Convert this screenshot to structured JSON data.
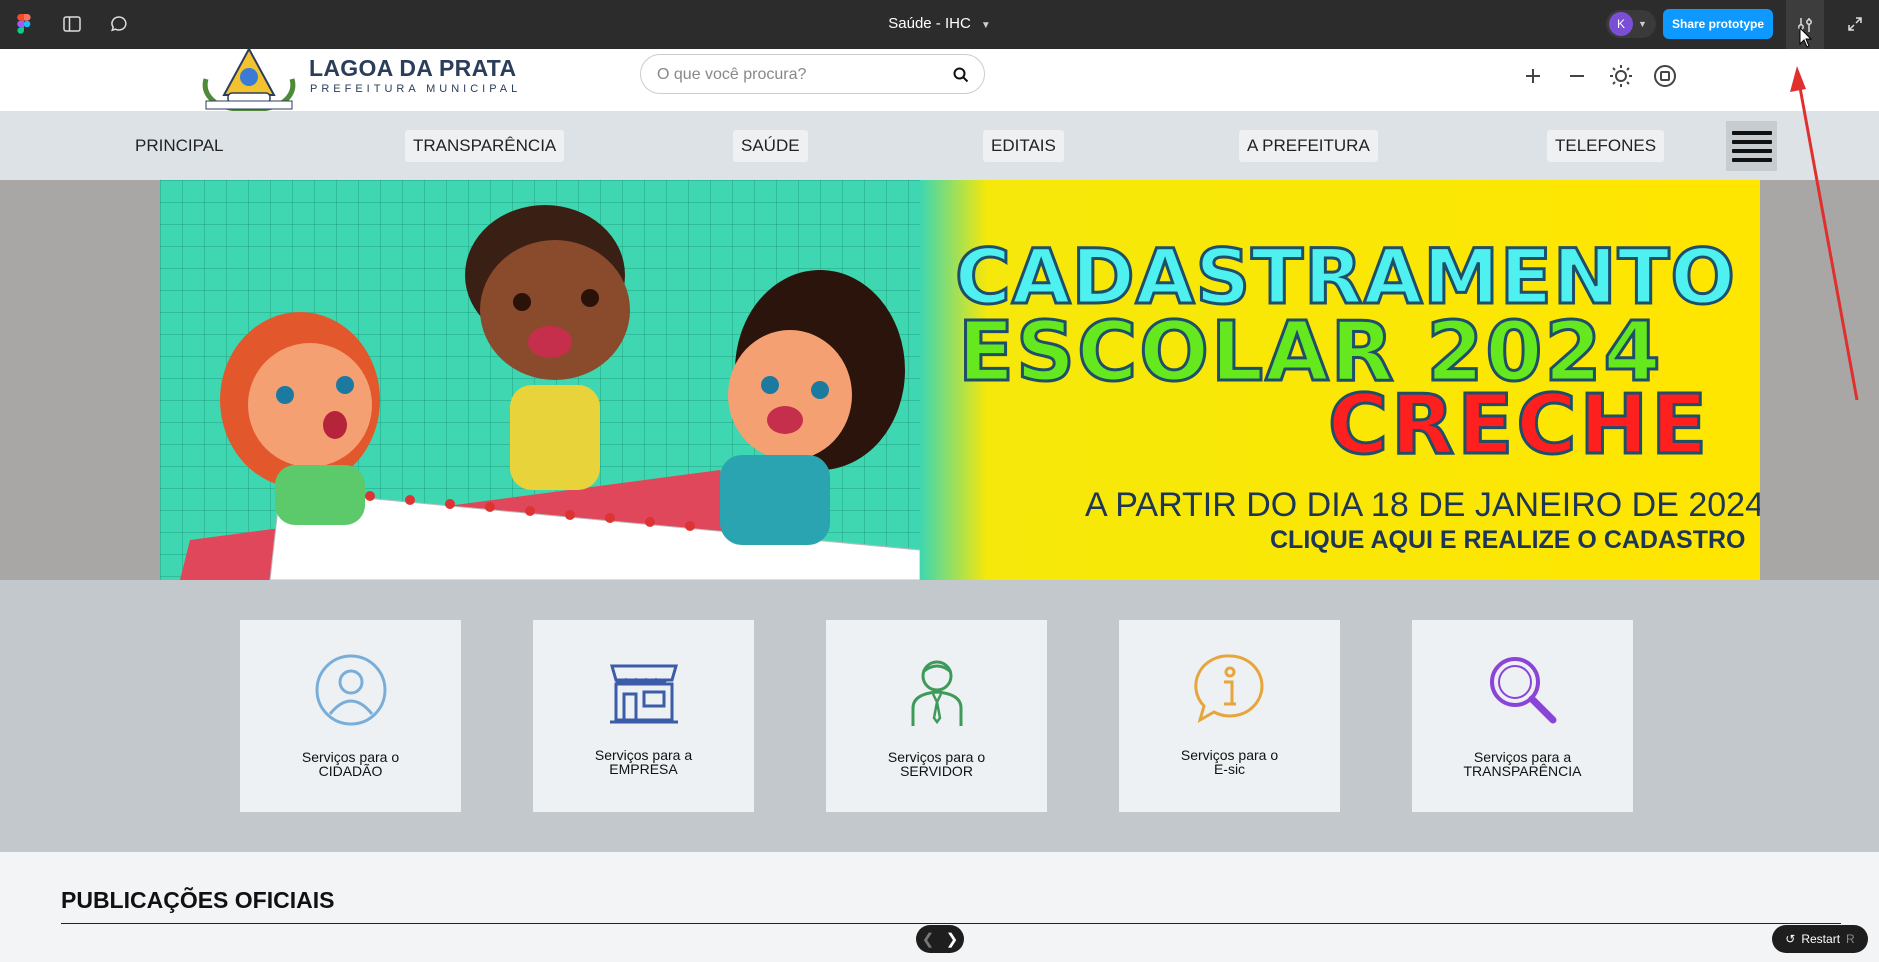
{
  "figma": {
    "file_title": "Saúde - IHC",
    "avatar_initial": "K",
    "share_label": "Share prototype",
    "icons": [
      "figma-logo-icon",
      "sidebar-toggle-icon",
      "comment-icon",
      "settings-sliders-icon",
      "fullscreen-icon"
    ]
  },
  "header": {
    "logo_title": "LAGOA DA PRATA",
    "logo_subtitle": "PREFEITURA MUNICIPAL",
    "search_placeholder": "O que você procura?",
    "tools": [
      "zoom-in-icon",
      "zoom-out-icon",
      "brightness-icon",
      "accessibility-icon"
    ]
  },
  "nav": {
    "items": [
      {
        "label": "PRINCIPAL"
      },
      {
        "label": "TRANSPARÊNCIA"
      },
      {
        "label": "SAÚDE"
      },
      {
        "label": "EDITAIS"
      },
      {
        "label": "A PREFEITURA"
      },
      {
        "label": "TELEFONES"
      }
    ]
  },
  "banner": {
    "line1": "CADASTRAMENTO",
    "line2": "ESCOLAR 2024",
    "line3": "CRECHE",
    "line4": "A PARTIR DO DIA 18 DE JANEIRO DE 2024",
    "line5": "CLIQUE AQUI E REALIZE O CADASTRO"
  },
  "services": [
    {
      "line1": "Serviços para o",
      "line2": "CIDADÃO",
      "icon": "user-icon"
    },
    {
      "line1": "Serviços para a",
      "line2": "EMPRESA",
      "icon": "storefront-icon"
    },
    {
      "line1": "Serviços para o",
      "line2": "SERVIDOR",
      "icon": "employee-icon"
    },
    {
      "line1": "Serviços para o",
      "line2": "E-sic",
      "icon": "info-bubble-icon"
    },
    {
      "line1": "Serviços para a",
      "line2": "TRANSPARÊNCIA",
      "icon": "magnifier-icon"
    }
  ],
  "publications": {
    "title": "PUBLICAÇÕES OFICIAIS"
  },
  "prototype": {
    "restart_label": "Restart",
    "restart_key": "R"
  },
  "colors": {
    "figma_bar": "#2c2c2c",
    "share_button": "#0d99ff",
    "nav_bg": "#dde2e7",
    "services_bg": "#c3c8cc",
    "banner_yellow": "#ffe600",
    "banner_green": "#3ed7b1",
    "annotation_arrow": "#e0302e"
  }
}
